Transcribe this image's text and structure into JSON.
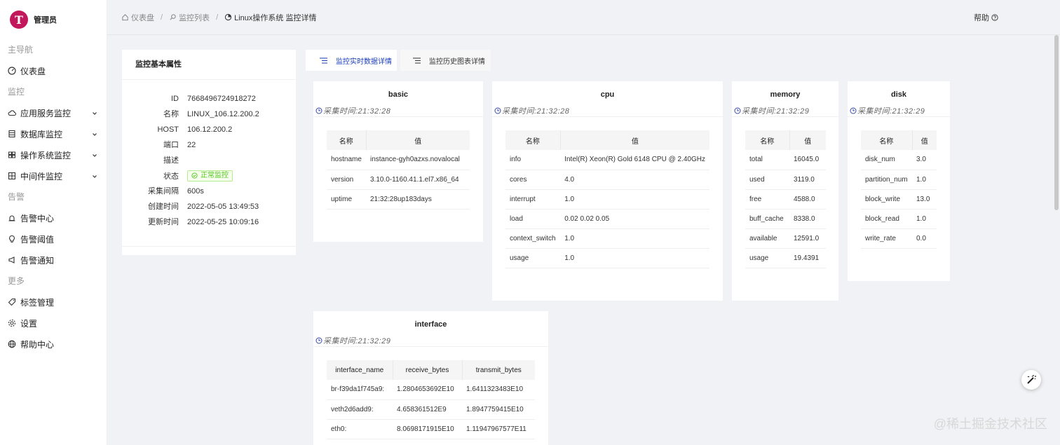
{
  "app": {
    "logo_letter": "T",
    "user": "管理员"
  },
  "nav": {
    "group_main": "主导航",
    "dashboard": "仪表盘",
    "group_monitor": "监控",
    "app_service": "应用服务监控",
    "database": "数据库监控",
    "os": "操作系统监控",
    "middleware": "中间件监控",
    "group_alert": "告警",
    "alert_center": "告警中心",
    "alert_threshold": "告警阈值",
    "alert_notify": "告警通知",
    "group_more": "更多",
    "tags": "标签管理",
    "settings": "设置",
    "help_center": "帮助中心"
  },
  "breadcrumb": {
    "home": "仪表盘",
    "list": "监控列表",
    "current": "Linux操作系统 监控详情"
  },
  "header": {
    "help": "帮助"
  },
  "attrs": {
    "title": "监控基本属性",
    "rows": [
      {
        "k": "ID",
        "v": "7668496724918272"
      },
      {
        "k": "名称",
        "v": "LINUX_106.12.200.2"
      },
      {
        "k": "HOST",
        "v": "106.12.200.2"
      },
      {
        "k": "端口",
        "v": "22"
      },
      {
        "k": "描述",
        "v": ""
      },
      {
        "k": "状态",
        "v": "正常监控"
      },
      {
        "k": "采集间隔",
        "v": "600s"
      },
      {
        "k": "创建时间",
        "v": "2022-05-05 13:49:53"
      },
      {
        "k": "更新时间",
        "v": "2022-05-25 10:09:16"
      }
    ]
  },
  "tabs": {
    "realtime": "监控实时数据详情",
    "history": "监控历史图表详情"
  },
  "cards": {
    "basic": {
      "title": "basic",
      "time": "采集时间:21:32:28",
      "cols": [
        "名称",
        "值"
      ],
      "rows": [
        [
          "hostname",
          "instance-gyh0azxs.novalocal"
        ],
        [
          "version",
          "3.10.0-1160.41.1.el7.x86_64"
        ],
        [
          "uptime",
          "21:32:28up183days"
        ]
      ]
    },
    "cpu": {
      "title": "cpu",
      "time": "采集时间:21:32:28",
      "cols": [
        "名称",
        "值"
      ],
      "rows": [
        [
          "info",
          "Intel(R) Xeon(R) Gold 6148 CPU @ 2.40GHz"
        ],
        [
          "cores",
          "4.0"
        ],
        [
          "interrupt",
          "1.0"
        ],
        [
          "load",
          "0.02 0.02 0.05"
        ],
        [
          "context_switch",
          "1.0"
        ],
        [
          "usage",
          "1.0"
        ]
      ]
    },
    "memory": {
      "title": "memory",
      "time": "采集时间:21:32:29",
      "cols": [
        "名称",
        "值"
      ],
      "rows": [
        [
          "total",
          "16045.0"
        ],
        [
          "used",
          "3119.0"
        ],
        [
          "free",
          "4588.0"
        ],
        [
          "buff_cache",
          "8338.0"
        ],
        [
          "available",
          "12591.0"
        ],
        [
          "usage",
          "19.4391"
        ]
      ]
    },
    "disk": {
      "title": "disk",
      "time": "采集时间:21:32:29",
      "cols": [
        "名称",
        "值"
      ],
      "rows": [
        [
          "disk_num",
          "3.0"
        ],
        [
          "partition_num",
          "1.0"
        ],
        [
          "block_write",
          "13.0"
        ],
        [
          "block_read",
          "1.0"
        ],
        [
          "write_rate",
          "0.0"
        ]
      ]
    },
    "interface": {
      "title": "interface",
      "time": "采集时间:21:32:29",
      "cols": [
        "interface_name",
        "receive_bytes",
        "transmit_bytes"
      ],
      "rows": [
        [
          "br-f39da1f745a9:",
          "1.2804653692E10",
          "1.6411323483E10"
        ],
        [
          "veth2d6add9:",
          "4.658361512E9",
          "1.8947759415E10"
        ],
        [
          "eth0:",
          "8.0698171915E10",
          "1.11947967577E11"
        ]
      ]
    }
  },
  "watermark": "@稀土掘金技术社区"
}
